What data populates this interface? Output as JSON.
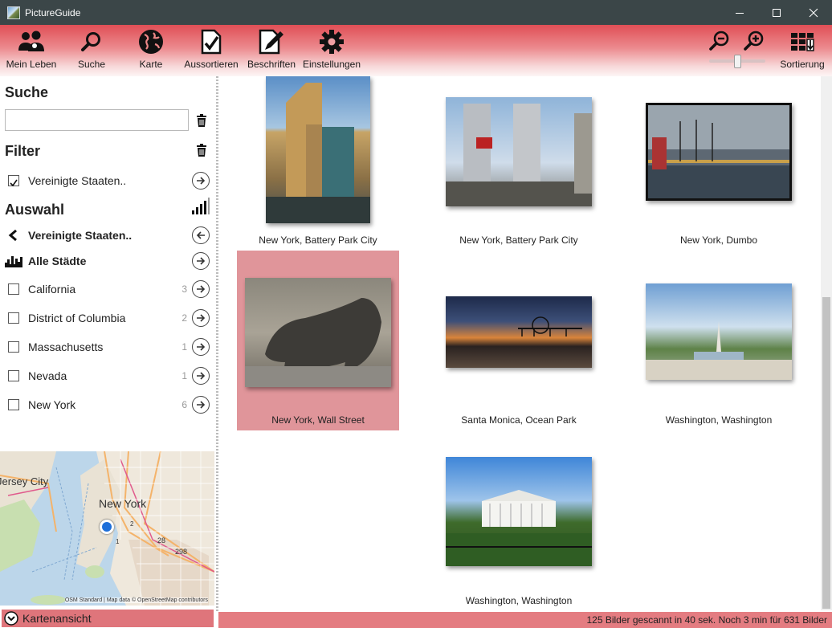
{
  "window": {
    "title": "PictureGuide"
  },
  "toolbar": {
    "buttons": [
      {
        "label": "Mein Leben",
        "icon": "people-icon"
      },
      {
        "label": "Suche",
        "icon": "search-icon"
      },
      {
        "label": "Karte",
        "icon": "globe-icon"
      },
      {
        "label": "Aussortieren",
        "icon": "document-check-icon"
      },
      {
        "label": "Beschriften",
        "icon": "document-pencil-icon"
      },
      {
        "label": "Einstellungen",
        "icon": "gear-icon"
      }
    ],
    "zoom_out_icon": "zoom-out-icon",
    "zoom_in_icon": "zoom-in-icon",
    "zoom_level": 0.5,
    "sort_label": "Sortierung",
    "sort_icon": "sort-grid-icon"
  },
  "sidebar": {
    "search": {
      "heading": "Suche",
      "value": "",
      "placeholder": ""
    },
    "filter": {
      "heading": "Filter",
      "items": [
        {
          "label": "Vereinigte Staaten..",
          "checked": true
        }
      ]
    },
    "selection": {
      "heading": "Auswahl",
      "back_item": "Vereinigte Staaten..",
      "all_item": "Alle Städte",
      "items": [
        {
          "label": "California",
          "count": "3",
          "checked": false
        },
        {
          "label": "District of Columbia",
          "count": "2",
          "checked": false
        },
        {
          "label": "Massachusetts",
          "count": "1",
          "checked": false
        },
        {
          "label": "Nevada",
          "count": "1",
          "checked": false
        },
        {
          "label": "New York",
          "count": "6",
          "checked": false
        }
      ]
    },
    "map": {
      "labels": {
        "jersey_city": "Jersey City",
        "new_york": "New York",
        "n1": "1",
        "n2": "2",
        "n28": "28",
        "n298": "298"
      },
      "attribution": "OSM Standard | Map data © OpenStreetMap contributors",
      "footer_label": "Kartenansicht"
    }
  },
  "grid": {
    "photos": [
      {
        "caption": "New York, Battery Park City",
        "selected": false
      },
      {
        "caption": "New York, Battery Park City",
        "selected": false
      },
      {
        "caption": "New York, Dumbo",
        "selected": false
      },
      {
        "caption": "New York, Wall Street",
        "selected": true
      },
      {
        "caption": "Santa Monica, Ocean Park",
        "selected": false
      },
      {
        "caption": "Washington, Washington",
        "selected": false
      },
      {
        "caption": "Washington, Washington",
        "selected": false
      }
    ]
  },
  "status": {
    "text": "125 Bilder gescannt in 40 sek. Noch 3 min für 631 Bilder"
  },
  "colors": {
    "accent": "#e04f56",
    "selection": "#e0959a",
    "titlebar": "#3b4648"
  }
}
